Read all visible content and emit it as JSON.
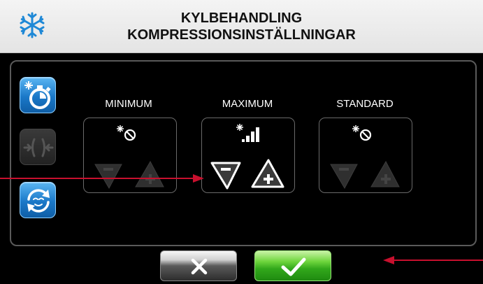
{
  "header": {
    "title_line1": "KYLBEHANDLING",
    "title_line2": "KOMPRESSIONSINSTÄLLNINGAR",
    "icon": "snowflake-icon"
  },
  "sidebar": {
    "items": [
      {
        "name": "cooling-timer-icon",
        "state": "active"
      },
      {
        "name": "compression-icon",
        "state": "disabled"
      },
      {
        "name": "cycle-relax-icon",
        "state": "active"
      }
    ]
  },
  "settings": {
    "columns": [
      {
        "label": "MINIMUM",
        "indicator": "cooling-off-icon",
        "level": 0,
        "enabled": false
      },
      {
        "label": "MAXIMUM",
        "indicator": "cooling-signal-icon",
        "level": 4,
        "enabled": true
      },
      {
        "label": "STANDARD",
        "indicator": "cooling-off-icon",
        "level": 0,
        "enabled": false
      }
    ]
  },
  "colors": {
    "accent_blue": "#1a78c8",
    "confirm_green": "#32a81b",
    "annotation_red": "#c8102e"
  },
  "footer": {
    "cancel_icon": "close-icon",
    "confirm_icon": "checkmark-icon"
  }
}
